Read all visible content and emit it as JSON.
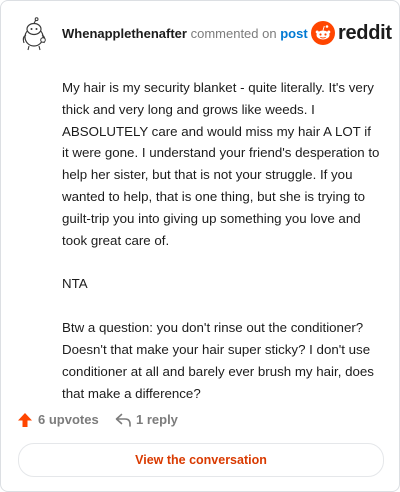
{
  "header": {
    "username": "Whenapplethenafter",
    "commented_on": "commented on",
    "post_link": "post",
    "brand_word": "reddit"
  },
  "comment": {
    "paragraphs": [
      "My hair is my security blanket - quite literally. It's very thick and very long and grows like weeds. I ABSOLUTELY care and would miss my hair A LOT if it were gone. I understand your friend's desperation to help her sister, but that is not your struggle. If you wanted to help, that is one thing, but she is trying to guilt-trip you into giving up something you love and took great care of.",
      "NTA",
      "Btw a question: you don't rinse out the conditioner? Doesn't that make your hair super sticky? I don't use conditioner at all and barely ever brush my hair, does that make a difference?"
    ]
  },
  "actions": {
    "upvotes": "6 upvotes",
    "replies": "1 reply"
  },
  "footer": {
    "view_button": "View the conversation"
  },
  "colors": {
    "accent": "#ff4500",
    "link": "#0079d3",
    "button_text": "#d93a00"
  },
  "icons": {
    "avatar": "snoo-avatar-icon",
    "brand": "reddit-logo-icon",
    "upvote": "upvote-arrow-icon",
    "reply": "reply-arrow-icon"
  }
}
